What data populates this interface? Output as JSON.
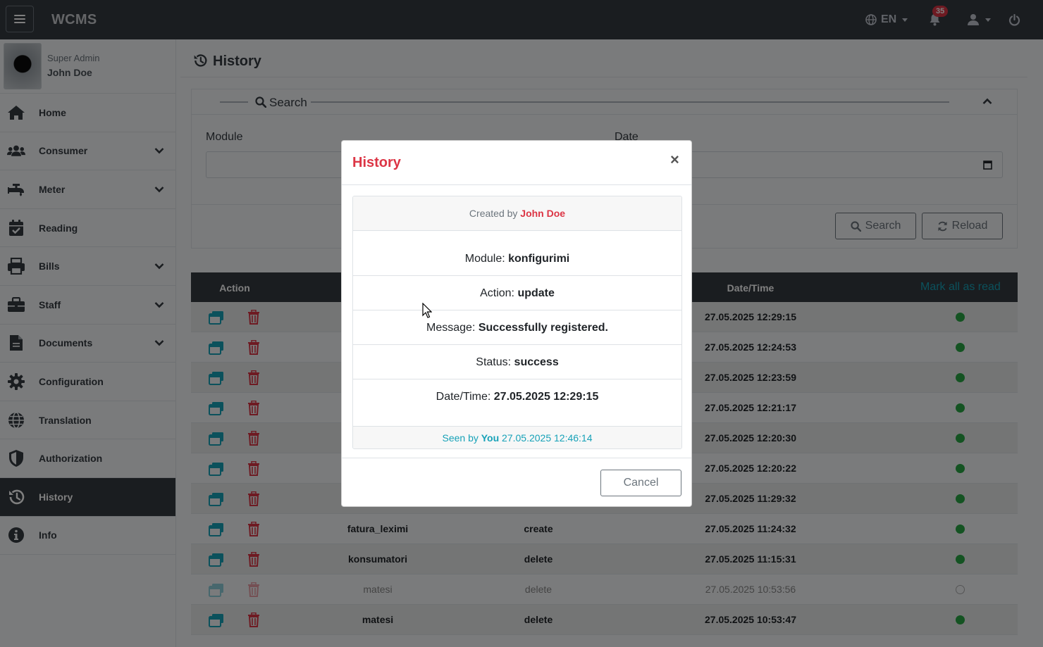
{
  "app": {
    "brand": "WCMS",
    "language": "EN",
    "notifications_count": "35"
  },
  "user": {
    "role": "Super Admin",
    "name": "John Doe"
  },
  "sidebar": {
    "items": [
      {
        "label": "Home",
        "icon": "home-icon",
        "has_children": false,
        "active": false
      },
      {
        "label": "Consumer",
        "icon": "users-icon",
        "has_children": true,
        "active": false
      },
      {
        "label": "Meter",
        "icon": "faucet-icon",
        "has_children": true,
        "active": false
      },
      {
        "label": "Reading",
        "icon": "calendar-check-icon",
        "has_children": false,
        "active": false
      },
      {
        "label": "Bills",
        "icon": "print-icon",
        "has_children": true,
        "active": false
      },
      {
        "label": "Staff",
        "icon": "briefcase-icon",
        "has_children": true,
        "active": false
      },
      {
        "label": "Documents",
        "icon": "file-icon",
        "has_children": true,
        "active": false
      },
      {
        "label": "Configuration",
        "icon": "cog-icon",
        "has_children": false,
        "active": false
      },
      {
        "label": "Translation",
        "icon": "globe-icon",
        "has_children": false,
        "active": false
      },
      {
        "label": "Authorization",
        "icon": "shield-icon",
        "has_children": false,
        "active": false
      },
      {
        "label": "History",
        "icon": "history-icon",
        "has_children": false,
        "active": true
      },
      {
        "label": "Info",
        "icon": "info-icon",
        "has_children": false,
        "active": false
      }
    ]
  },
  "page": {
    "title": "History"
  },
  "search": {
    "legend": "Search",
    "module_label": "Module",
    "date_label": "Date",
    "search_button": "Search",
    "reload_button": "Reload"
  },
  "table": {
    "headers": {
      "action": "Action",
      "datetime": "Date/Time"
    },
    "mark_all_read": "Mark all as read",
    "rows": [
      {
        "module": "",
        "action": "",
        "datetime": "27.05.2025 12:29:15",
        "seen": false
      },
      {
        "module": "",
        "action": "",
        "datetime": "27.05.2025 12:24:53",
        "seen": false
      },
      {
        "module": "",
        "action": "",
        "datetime": "27.05.2025 12:23:59",
        "seen": false
      },
      {
        "module": "",
        "action": "",
        "datetime": "27.05.2025 12:21:17",
        "seen": false
      },
      {
        "module": "",
        "action": "",
        "datetime": "27.05.2025 12:20:30",
        "seen": false
      },
      {
        "module": "",
        "action": "",
        "datetime": "27.05.2025 12:20:22",
        "seen": false
      },
      {
        "module": "",
        "action": "",
        "datetime": "27.05.2025 11:29:32",
        "seen": false
      },
      {
        "module": "fatura_leximi",
        "action": "create",
        "datetime": "27.05.2025 11:24:32",
        "seen": false
      },
      {
        "module": "konsumatori",
        "action": "delete",
        "datetime": "27.05.2025 11:15:31",
        "seen": false
      },
      {
        "module": "matesi",
        "action": "delete",
        "datetime": "27.05.2025 10:53:56",
        "seen": true
      },
      {
        "module": "matesi",
        "action": "delete",
        "datetime": "27.05.2025 10:53:47",
        "seen": false
      }
    ]
  },
  "modal": {
    "title": "History",
    "close": "×",
    "created_by_prefix": "Created by",
    "created_by": "John Doe",
    "module_label": "Module:",
    "module_value": "konfigurimi",
    "action_label": "Action:",
    "action_value": "update",
    "message_label": "Message:",
    "message_value": "Successfully registered.",
    "status_label": "Status:",
    "status_value": "success",
    "datetime_label": "Date/Time:",
    "datetime_value": "27.05.2025 12:29:15",
    "seen_prefix": "Seen by",
    "seen_by": "You",
    "seen_at": "27.05.2025 12:46:14",
    "cancel_button": "Cancel"
  },
  "colors": {
    "accent": "#dc3545",
    "info": "#17a2b8",
    "dark": "#343a40",
    "success": "#28a745"
  }
}
